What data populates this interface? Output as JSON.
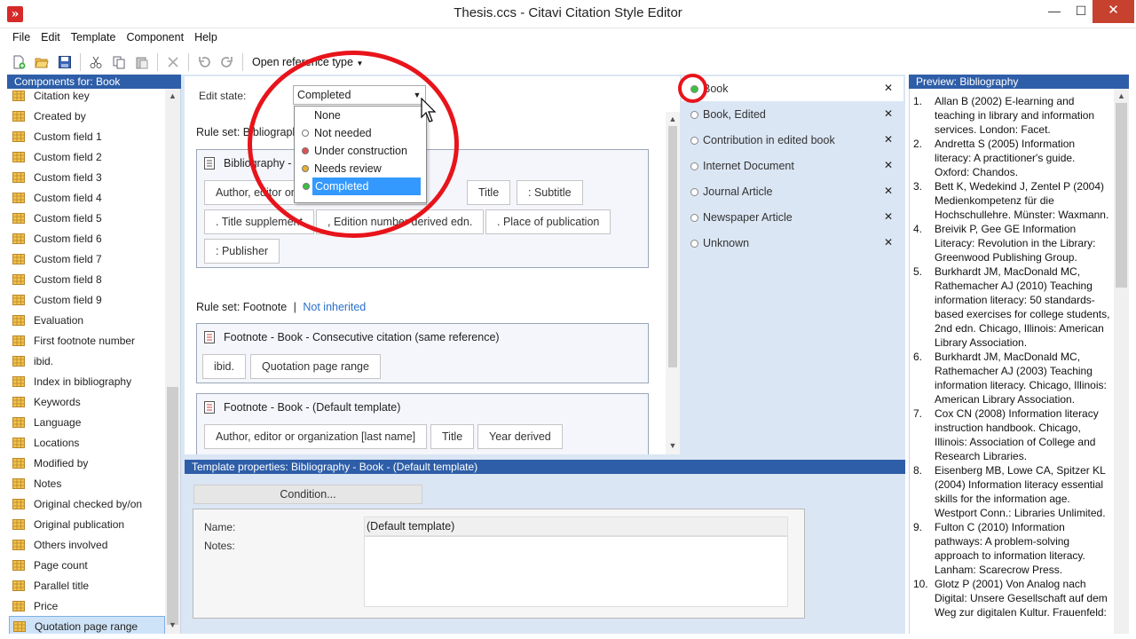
{
  "window": {
    "title": "Thesis.ccs - Citavi Citation Style Editor",
    "min_glyph": "—",
    "max_glyph": "☐",
    "close_glyph": "✕"
  },
  "menu": [
    "File",
    "Edit",
    "Template",
    "Component",
    "Help"
  ],
  "toolbar": {
    "open_reference_type": "Open reference type"
  },
  "left_panel": {
    "title": "Components for: Book",
    "items": [
      "Citation key",
      "Created by",
      "Custom field 1",
      "Custom field 2",
      "Custom field 3",
      "Custom field 4",
      "Custom field 5",
      "Custom field 6",
      "Custom field 7",
      "Custom field 8",
      "Custom field 9",
      "Evaluation",
      "First footnote number",
      "ibid.",
      "Index in bibliography",
      "Keywords",
      "Language",
      "Locations",
      "Modified by",
      "Notes",
      "Original checked by/on",
      "Original publication",
      "Others involved",
      "Page count",
      "Parallel title",
      "Price",
      "Quotation page range"
    ],
    "selected": "Quotation page range"
  },
  "editor": {
    "edit_state_label": "Edit state:",
    "edit_state_value": "Completed",
    "ruleset_bib": "Rule set: Bibliography",
    "bib_template_title": "Bibliography - Book - (Default template)",
    "bib_chips": [
      "Author, editor or organization [last name]",
      "Title",
      ": Subtitle",
      ". Title supplement",
      ", Edition number derived edn.",
      ". Place of publication",
      ": Publisher"
    ],
    "ruleset_footnote": "Rule set: Footnote",
    "ruleset_separator": "|",
    "not_inherited": "Not inherited",
    "fn1_title": "Footnote - Book - Consecutive citation (same reference)",
    "fn1_chips": [
      "ibid.",
      "Quotation page range"
    ],
    "fn2_title": "Footnote - Book - (Default template)",
    "fn2_chips": [
      "Author, editor or organization [last name]",
      "Title",
      "Year derived"
    ]
  },
  "dropdown": {
    "options": [
      {
        "label": "None",
        "color": "none"
      },
      {
        "label": "Not needed",
        "color": "#ffffff"
      },
      {
        "label": "Under construction",
        "color": "#e05050"
      },
      {
        "label": "Needs review",
        "color": "#e8b030"
      },
      {
        "label": "Completed",
        "color": "#3cc040"
      }
    ],
    "selected": "Completed"
  },
  "reference_types": [
    {
      "label": "Book",
      "active": true,
      "dot": "#3cc040"
    },
    {
      "label": "Book, Edited",
      "active": false,
      "dot": "#ffffff"
    },
    {
      "label": "Contribution in edited book",
      "active": false,
      "dot": "#ffffff"
    },
    {
      "label": "Internet Document",
      "active": false,
      "dot": "#ffffff"
    },
    {
      "label": "Journal Article",
      "active": false,
      "dot": "#ffffff"
    },
    {
      "label": "Newspaper Article",
      "active": false,
      "dot": "#ffffff"
    },
    {
      "label": "Unknown",
      "active": false,
      "dot": "#ffffff"
    }
  ],
  "properties": {
    "title": "Template properties:  Bibliography - Book - (Default template)",
    "condition_button": "Condition...",
    "name_label": "Name:",
    "name_value": "(Default template)",
    "notes_label": "Notes:"
  },
  "preview": {
    "title": "Preview: Bibliography",
    "entries": [
      {
        "num": "1.",
        "text": "Allan B (2002) E-learning and teaching in library and information services. London: Facet."
      },
      {
        "num": "2.",
        "text": "Andretta S (2005) Information literacy: A practitioner's guide. Oxford: Chandos."
      },
      {
        "num": "3.",
        "text": "Bett K, Wedekind J, Zentel P (2004) Medienkompetenz für die Hochschullehre. Münster: Waxmann."
      },
      {
        "num": "4.",
        "text": "Breivik P, Gee GE Information Literacy: Revolution in the Library: Greenwood Publishing Group."
      },
      {
        "num": "5.",
        "text": "Burkhardt JM, MacDonald MC, Rathemacher AJ (2010) Teaching information literacy: 50 standards-based exercises for college students, 2nd edn. Chicago, Illinois: American Library Association."
      },
      {
        "num": "6.",
        "text": "Burkhardt JM, MacDonald MC, Rathemacher AJ (2003) Teaching information literacy. Chicago, Illinois: American Library Association."
      },
      {
        "num": "7.",
        "text": "Cox CN (2008) Information literacy instruction handbook. Chicago, Illinois: Association of College and Research Libraries."
      },
      {
        "num": "8.",
        "text": "Eisenberg MB, Lowe CA, Spitzer KL (2004) Information literacy essential skills for the information age. Westport Conn.: Libraries Unlimited."
      },
      {
        "num": "9.",
        "text": "Fulton C (2010) Information pathways: A problem-solving approach to information literacy. Lanham: Scarecrow Press."
      },
      {
        "num": "10.",
        "text": "Glotz P (2001) Von Analog nach Digital: Unsere Gesellschaft auf dem Weg zur digitalen Kultur. Frauenfeld:"
      }
    ]
  },
  "colors": {
    "accent": "#2e5ea8",
    "annotation": "#e8141b"
  }
}
